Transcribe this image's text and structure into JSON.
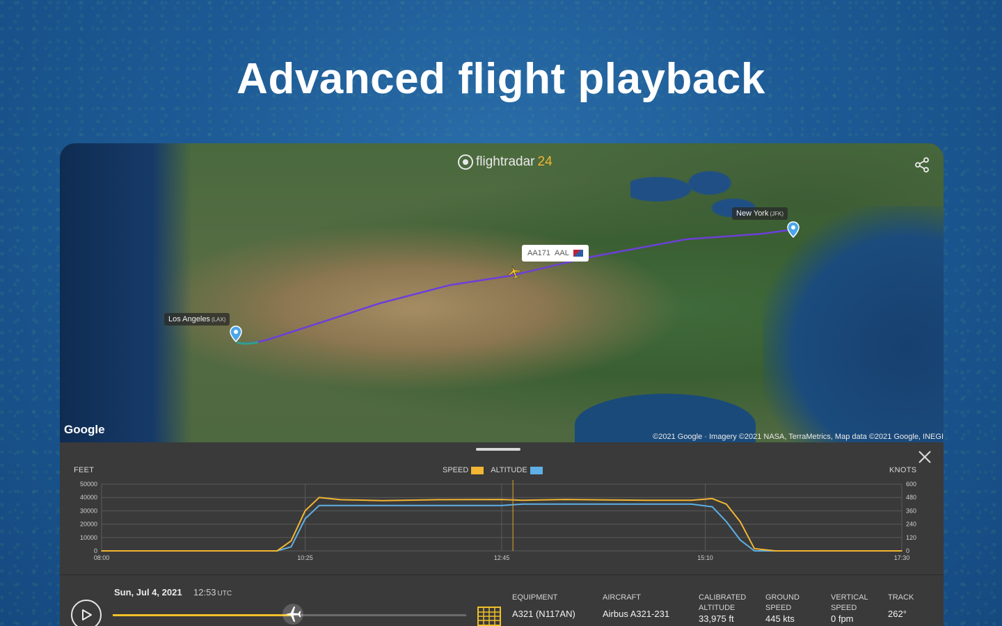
{
  "headline": "Advanced flight playback",
  "brand": {
    "name": "flightradar",
    "suffix": "24"
  },
  "map": {
    "origin_label": "Los Angeles",
    "origin_code": "(LAX)",
    "destination_label": "New York",
    "destination_code": "(JFK)",
    "flight_tag": "AA171",
    "flight_tag_code": "AAL",
    "provider": "Google",
    "attribution": "©2021 Google · Imagery ©2021 NASA, TerraMetrics, Map data ©2021 Google, INEGI"
  },
  "panel": {
    "left_unit": "FEET",
    "right_unit": "KNOTS",
    "legend": [
      {
        "label": "SPEED",
        "color": "#f2b632"
      },
      {
        "label": "ALTITUDE",
        "color": "#5fb0e6"
      }
    ],
    "date": "Sun, Jul 4, 2021",
    "time": "12:53",
    "timezone": "UTC",
    "playback_progress": 0.51,
    "stats": [
      {
        "label": "EQUIPMENT",
        "value": "A321 (N117AN)"
      },
      {
        "label": "AIRCRAFT",
        "value": "Airbus A321-231"
      },
      {
        "label": "CALIBRATED ALTITUDE",
        "value": "33,975 ft"
      },
      {
        "label": "GROUND SPEED",
        "value": "445 kts"
      },
      {
        "label": "VERTICAL SPEED",
        "value": "0 fpm"
      },
      {
        "label": "TRACK",
        "value": "262°"
      }
    ]
  },
  "chart_data": {
    "type": "line",
    "x": [
      "08:00",
      "08:40",
      "09:20",
      "10:05",
      "10:15",
      "10:25",
      "10:35",
      "10:50",
      "11:20",
      "12:00",
      "12:45",
      "13:00",
      "13:30",
      "14:00",
      "14:30",
      "15:00",
      "15:15",
      "15:25",
      "15:35",
      "15:45",
      "16:00",
      "16:30",
      "17:00",
      "17:30"
    ],
    "x_ticks": [
      "08:00",
      "10:25",
      "12:45",
      "15:10",
      "17:30"
    ],
    "series": [
      {
        "name": "SPEED",
        "axis": "right",
        "values": [
          0,
          0,
          0,
          0,
          90,
          360,
          480,
          460,
          452,
          460,
          462,
          455,
          462,
          458,
          455,
          455,
          470,
          420,
          260,
          20,
          0,
          0,
          0,
          0
        ]
      },
      {
        "name": "ALTITUDE",
        "axis": "left",
        "values": [
          0,
          0,
          0,
          0,
          3000,
          24000,
          34000,
          34000,
          34000,
          34000,
          34000,
          35000,
          35000,
          35000,
          35000,
          35000,
          33000,
          22000,
          8000,
          0,
          0,
          0,
          0,
          0
        ]
      }
    ],
    "y_left_ticks": [
      "0",
      "10000",
      "20000",
      "30000",
      "40000",
      "50000"
    ],
    "y_left_range": [
      0,
      50000
    ],
    "y_right_ticks": [
      "0",
      "120",
      "240",
      "360",
      "480",
      "600"
    ],
    "y_right_range": [
      0,
      600
    ],
    "cursor_time": "12:53",
    "grid": true
  }
}
